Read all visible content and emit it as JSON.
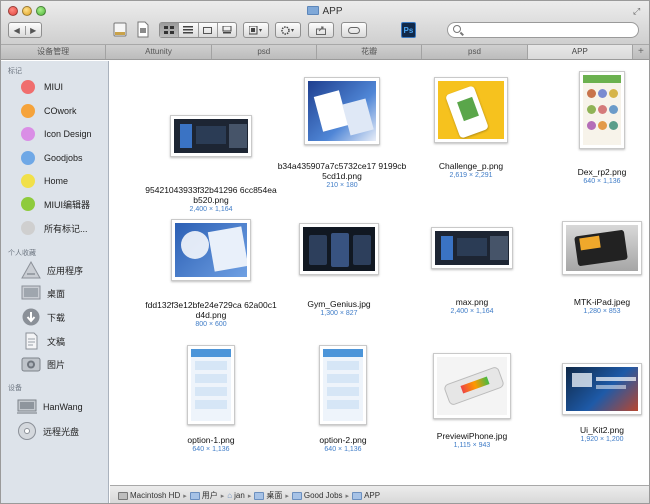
{
  "window": {
    "title": "APP"
  },
  "tabs": [
    "设备管理",
    "Attunity",
    "psd",
    "花瓣",
    "psd",
    "APP"
  ],
  "active_tab": 5,
  "sidebar": {
    "tags_header": "标记",
    "tags": [
      {
        "label": "MIUI",
        "color": "#f06e6e"
      },
      {
        "label": "COwork",
        "color": "#f5a33b"
      },
      {
        "label": "Icon Design",
        "color": "#da8ee6"
      },
      {
        "label": "Goodjobs",
        "color": "#6fa8e6"
      },
      {
        "label": "Home",
        "color": "#f1e04a"
      },
      {
        "label": "MIUI编辑器",
        "color": "#8ecb3c"
      },
      {
        "label": "所有标记...",
        "color": "#cfcfcf"
      }
    ],
    "favorites_header": "个人收藏",
    "favorites": [
      {
        "label": "应用程序",
        "icon": "applications-icon"
      },
      {
        "label": "桌面",
        "icon": "desktop-icon"
      },
      {
        "label": "下载",
        "icon": "downloads-icon"
      },
      {
        "label": "文稿",
        "icon": "documents-icon"
      },
      {
        "label": "图片",
        "icon": "pictures-icon"
      }
    ],
    "devices_header": "设备",
    "devices": [
      {
        "label": "HanWang",
        "icon": "computer-icon"
      },
      {
        "label": "远程光盘",
        "icon": "remote-disc-icon"
      }
    ]
  },
  "files": [
    {
      "name": "95421043933f32b41296 6cc854eab520.png",
      "dims": "2,400 × 1,164",
      "style": "dark-wide"
    },
    {
      "name": "b34a435907a7c5732ce17 9199cb5cd1d.png",
      "dims": "210 × 180",
      "style": "blue-square"
    },
    {
      "name": "Challenge_p.png",
      "dims": "2,619 × 2,291",
      "style": "yellow-phone"
    },
    {
      "name": "Dex_rp2.png",
      "dims": "640 × 1,136",
      "style": "list-phone"
    },
    {
      "name": "fdd132f3e12bfe24e729ca 62a00c1d4d.png",
      "dims": "800 × 600",
      "style": "blue-ui"
    },
    {
      "name": "Gym_Genius.jpg",
      "dims": "1,300 × 827",
      "style": "dark-phones"
    },
    {
      "name": "max.png",
      "dims": "2,400 × 1,164",
      "style": "dark-wide"
    },
    {
      "name": "MTK-iPad.jpeg",
      "dims": "1,280 × 853",
      "style": "ipad"
    },
    {
      "name": "option-1.png",
      "dims": "640 × 1,136",
      "style": "phone-blue"
    },
    {
      "name": "option-2.png",
      "dims": "640 × 1,136",
      "style": "phone-blue"
    },
    {
      "name": "PreviewiPhone.jpg",
      "dims": "1,115 × 943",
      "style": "white-phone"
    },
    {
      "name": "Ui_Kit2.png",
      "dims": "1,920 × 1,200",
      "style": "ui-kit"
    }
  ],
  "pathbar": [
    "Macintosh HD",
    "用户",
    "jan",
    "桌面",
    "Good Jobs",
    "APP"
  ]
}
